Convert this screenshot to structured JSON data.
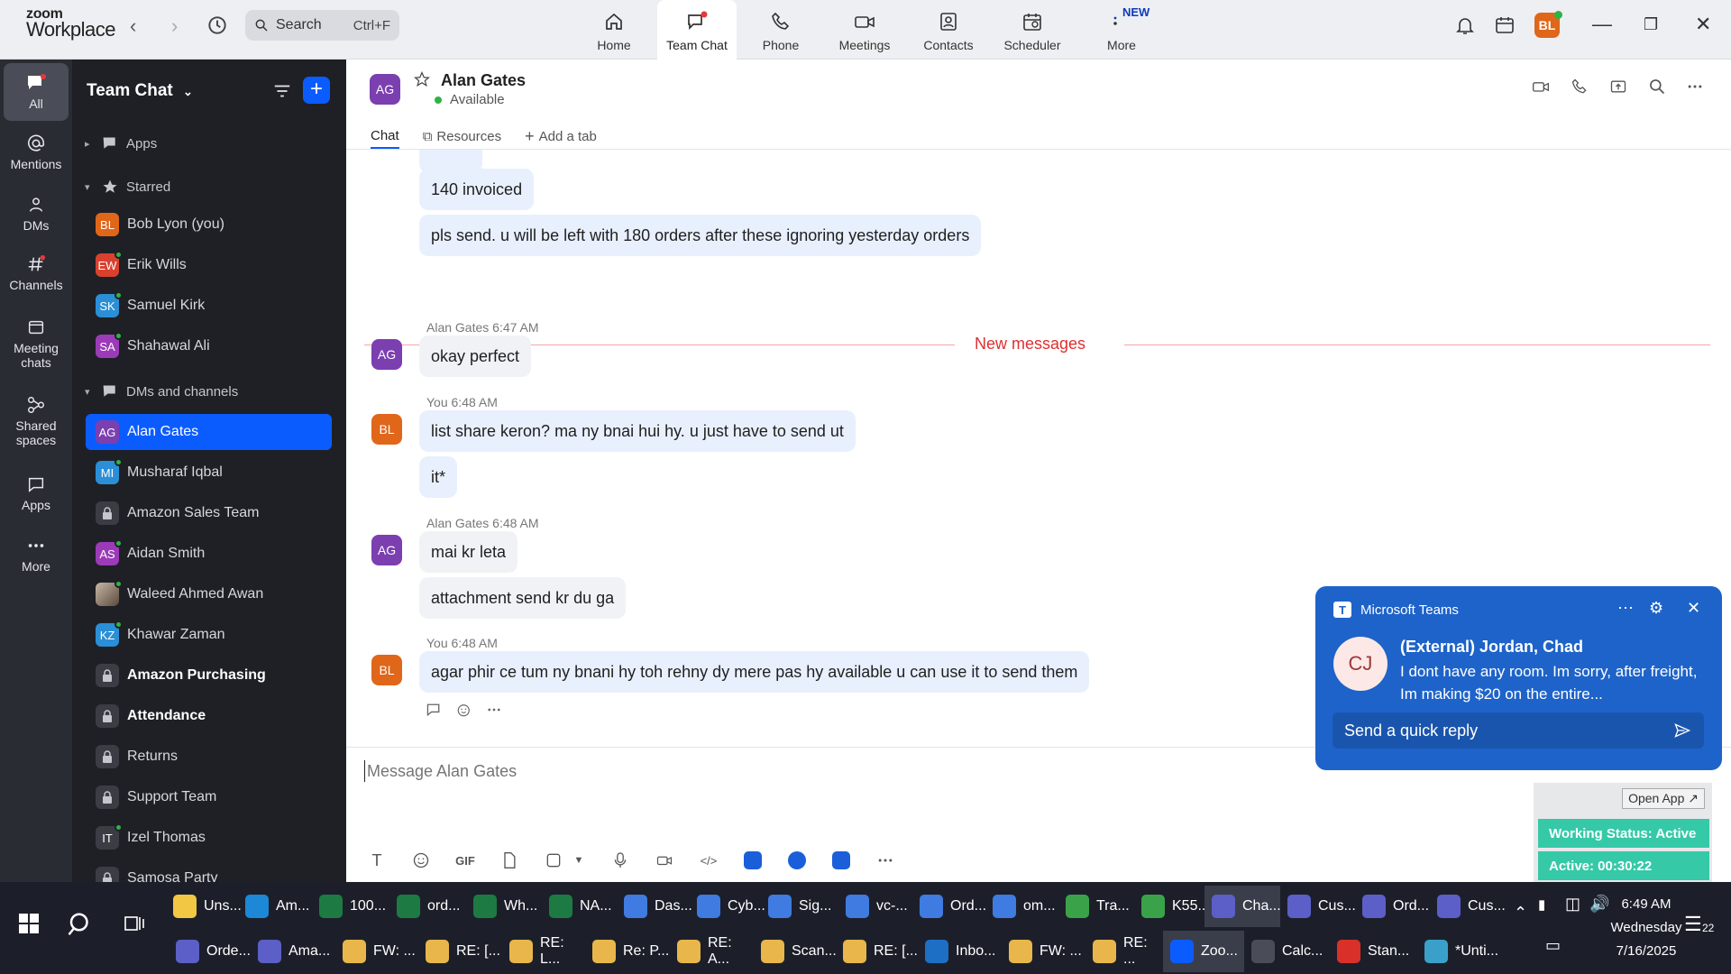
{
  "app": {
    "logo_top": "zoom",
    "logo_bottom": "Workplace"
  },
  "search": {
    "label": "Search",
    "shortcut": "Ctrl+F"
  },
  "nav_tabs": [
    {
      "label": "Home",
      "icon": "home-icon"
    },
    {
      "label": "Team Chat",
      "icon": "chat-icon"
    },
    {
      "label": "Phone",
      "icon": "phone-icon"
    },
    {
      "label": "Meetings",
      "icon": "video-icon"
    },
    {
      "label": "Contacts",
      "icon": "contacts-icon"
    },
    {
      "label": "Scheduler",
      "icon": "calendar-icon"
    },
    {
      "label": "More",
      "icon": "more-icon"
    }
  ],
  "more_badge": "NEW",
  "user": {
    "initials": "BL",
    "color": "#e0661a"
  },
  "rail": [
    {
      "label": "All",
      "icon": "chat-icon"
    },
    {
      "label": "Mentions",
      "icon": "at-icon"
    },
    {
      "label": "DMs",
      "icon": "people-icon"
    },
    {
      "label": "Channels",
      "icon": "hash-icon"
    },
    {
      "label": "Meeting chats",
      "icon": "meeting-icon"
    },
    {
      "label": "Shared spaces",
      "icon": "shared-icon"
    },
    {
      "label": "Apps",
      "icon": "apps-icon"
    },
    {
      "label": "More",
      "icon": "more-icon"
    }
  ],
  "panel": {
    "title": "Team Chat",
    "apps_label": "Apps",
    "starred_label": "Starred",
    "dms_label": "DMs and channels",
    "starred": [
      {
        "initials": "BL",
        "name": "Bob Lyon (you)",
        "color": "#e0661a"
      },
      {
        "initials": "EW",
        "name": "Erik Wills",
        "color": "#d9412e"
      },
      {
        "initials": "SK",
        "name": "Samuel Kirk",
        "color": "#2a8fd6"
      },
      {
        "initials": "SA",
        "name": "Shahawal Ali",
        "color": "#9b3bb8"
      }
    ],
    "dms": [
      {
        "initials": "AG",
        "name": "Alan Gates",
        "color": "#7b3fb0",
        "active": true
      },
      {
        "initials": "MI",
        "name": "Musharaf Iqbal",
        "color": "#2a8fd6"
      },
      {
        "initials": "",
        "name": "Amazon Sales Team",
        "lock": true
      },
      {
        "initials": "AS",
        "name": "Aidan Smith",
        "color": "#9b3bb8"
      },
      {
        "initials": "",
        "name": "Waleed Ahmed Awan",
        "photo": true
      },
      {
        "initials": "KZ",
        "name": "Khawar Zaman",
        "color": "#2a8fd6"
      },
      {
        "initials": "",
        "name": "Amazon Purchasing",
        "lock": true,
        "bold": true
      },
      {
        "initials": "",
        "name": "Attendance",
        "lock": true,
        "bold": true
      },
      {
        "initials": "",
        "name": "Returns",
        "lock": true
      },
      {
        "initials": "",
        "name": "Support Team",
        "lock": true
      },
      {
        "initials": "IT",
        "name": "Izel Thomas",
        "color": "#3b3d45"
      },
      {
        "initials": "",
        "name": "Samosa Party",
        "lock": true
      }
    ]
  },
  "conversation": {
    "contact": {
      "initials": "AG",
      "name": "Alan Gates",
      "status": "Available"
    },
    "tabs": [
      "Chat",
      "Resources",
      "Add a tab"
    ],
    "new_messages_label": "New messages",
    "messages": [
      {
        "text": "140 invoiced",
        "mine": true
      },
      {
        "text": "pls send. u will be left with 180 orders after these ignoring yesterday orders",
        "mine": true
      },
      {
        "sender": "Alan Gates",
        "time": "6:47 AM",
        "text": "okay perfect",
        "mine": false
      },
      {
        "sender": "You",
        "time": "6:48 AM",
        "text": "list share keron? ma ny bnai hui hy. u just have to send ut",
        "mine": true
      },
      {
        "text": "it*",
        "mine": true
      },
      {
        "sender": "Alan Gates",
        "time": "6:48 AM",
        "text": "mai kr leta",
        "mine": false
      },
      {
        "text": "attachment send kr du ga",
        "mine": false
      },
      {
        "sender": "You",
        "time": "6:48 AM",
        "text": "agar phir ce tum ny bnani hy toh rehny dy mere pas hy available u can use it to send them",
        "mine": true
      }
    ],
    "composer_placeholder": "Message Alan Gates",
    "gif_label": "GIF"
  },
  "teams_toast": {
    "app": "Microsoft Teams",
    "initials": "CJ",
    "from": "(External) Jordan, Chad",
    "message": "I dont have any room.  Im sorry, after freight, Im making $20 on the entire...",
    "reply_placeholder": "Send a quick reply"
  },
  "status_widget": {
    "open_label": "Open App ↗",
    "working_status": "Working Status: Active",
    "active_time": "Active: 00:30:22"
  },
  "taskbar": {
    "row1": [
      {
        "label": "Uns...",
        "color": "#f2c744"
      },
      {
        "label": "Am...",
        "color": "#1c88d6"
      },
      {
        "label": "100...",
        "color": "#1d7a43"
      },
      {
        "label": "ord...",
        "color": "#1d7a43"
      },
      {
        "label": "Wh...",
        "color": "#1d7a43"
      },
      {
        "label": "NA...",
        "color": "#1d7a43"
      },
      {
        "label": "Das...",
        "color": "#3f7be0"
      },
      {
        "label": "Cyb...",
        "color": "#3f7be0"
      },
      {
        "label": "Sig...",
        "color": "#3f7be0"
      },
      {
        "label": "vc-...",
        "color": "#3f7be0"
      },
      {
        "label": "Ord...",
        "color": "#3f7be0"
      },
      {
        "label": "om...",
        "color": "#3f7be0"
      },
      {
        "label": "Tra...",
        "color": "#3aa34a"
      },
      {
        "label": "K55...",
        "color": "#3aa34a"
      },
      {
        "label": "Cha...",
        "color": "#5b5fc7"
      },
      {
        "label": "Cus...",
        "color": "#5b5fc7"
      },
      {
        "label": "Ord...",
        "color": "#5b5fc7"
      },
      {
        "label": "Cus...",
        "color": "#5b5fc7"
      }
    ],
    "row2": [
      {
        "label": "Orde...",
        "color": "#5b5fc7"
      },
      {
        "label": "Ama...",
        "color": "#5b5fc7"
      },
      {
        "label": "FW: ...",
        "color": "#e8b64a"
      },
      {
        "label": "RE: [...",
        "color": "#e8b64a"
      },
      {
        "label": "RE: L...",
        "color": "#e8b64a"
      },
      {
        "label": "Re: P...",
        "color": "#e8b64a"
      },
      {
        "label": "RE: A...",
        "color": "#e8b64a"
      },
      {
        "label": "Scan...",
        "color": "#e8b64a"
      },
      {
        "label": "RE: [...",
        "color": "#e8b64a"
      },
      {
        "label": "Inbo...",
        "color": "#1c6fc4"
      },
      {
        "label": "FW: ...",
        "color": "#e8b64a"
      },
      {
        "label": "RE: ...",
        "color": "#e8b64a"
      },
      {
        "label": "Zoo...",
        "color": "#0b5cff"
      },
      {
        "label": "Calc...",
        "color": "#4a4d57"
      },
      {
        "label": "Stan...",
        "color": "#d9302a"
      },
      {
        "label": "*Unti...",
        "color": "#3aa0c9"
      }
    ],
    "time": "6:49 AM",
    "day": "Wednesday",
    "date": "7/16/2025",
    "notif_count": "22"
  }
}
